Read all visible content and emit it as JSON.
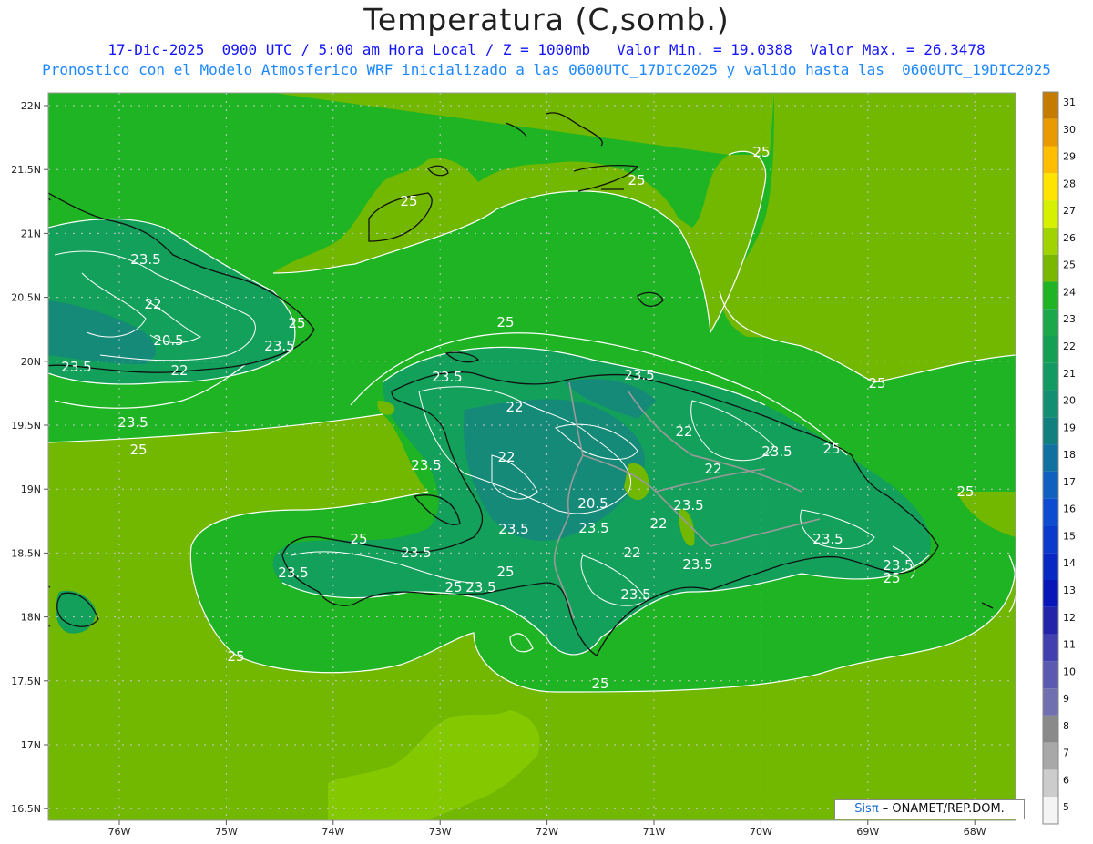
{
  "header": {
    "title": "Temperatura (C,somb.)",
    "line1": "17-Dic-2025  0900 UTC / 5:00 am Hora Local / Z = 1000mb   Valor Min. = 19.0388  Valor Max. = 26.3478",
    "line2": "Pronostico con el Modelo Atmosferico WRF inicializado a las 0600UTC_17DIC2025 y valido hasta las  0600UTC_19DIC2025"
  },
  "credit": {
    "brand": "Sisπ",
    "org": " – ONAMET/REP.DOM."
  },
  "map": {
    "lat_labels": [
      "22N",
      "21.5N",
      "21N",
      "20.5N",
      "20N",
      "19.5N",
      "19N",
      "18.5N",
      "18N",
      "17.5N",
      "17N",
      "16.5N"
    ],
    "lon_labels": [
      "76W",
      "75W",
      "74W",
      "73W",
      "72W",
      "71W",
      "70W",
      "69W",
      "68W"
    ],
    "colors": {
      "ocean": "#1eb423",
      "shallow": "#72b800",
      "warm": "#84c800",
      "cool": "#12a05a",
      "cold": "#158a78",
      "coast": "#111111",
      "border": "#9a9a9a",
      "contour": "#ffffff"
    },
    "contour_labels": [
      "25",
      "25",
      "25",
      "25",
      "25",
      "25",
      "25",
      "25",
      "25",
      "25",
      "25",
      "25",
      "25",
      "25",
      "25",
      "23.5",
      "23.5",
      "23.5",
      "23.5",
      "23.5",
      "23.5",
      "23.5",
      "23.5",
      "23.5",
      "23.5",
      "23.5",
      "23.5",
      "23.5",
      "23.5",
      "23.5",
      "23.5",
      "23.5",
      "23.5",
      "22",
      "22",
      "22",
      "22",
      "22",
      "22",
      "22",
      "22",
      "20.5",
      "20.5"
    ]
  },
  "colorbar": {
    "values": [
      "31",
      "30",
      "29",
      "28",
      "27",
      "26",
      "25",
      "24",
      "23",
      "22",
      "21",
      "20",
      "19",
      "18",
      "17",
      "16",
      "15",
      "14",
      "13",
      "12",
      "11",
      "10",
      "9",
      "8",
      "7",
      "6",
      "5"
    ],
    "colors": [
      "#c47b00",
      "#e89a00",
      "#ffbe00",
      "#ffe400",
      "#d6f000",
      "#9fd400",
      "#78b800",
      "#1eb423",
      "#1aa84a",
      "#14a054",
      "#129a62",
      "#128e72",
      "#10807e",
      "#1070a0",
      "#1060c0",
      "#0d4cd0",
      "#0a3acc",
      "#0828c4",
      "#0616b8",
      "#2424aa",
      "#4040b0",
      "#5a5ab0",
      "#7070b0",
      "#8a8a8a",
      "#a8a8a8",
      "#cccccc",
      "#f4f4f4"
    ]
  }
}
